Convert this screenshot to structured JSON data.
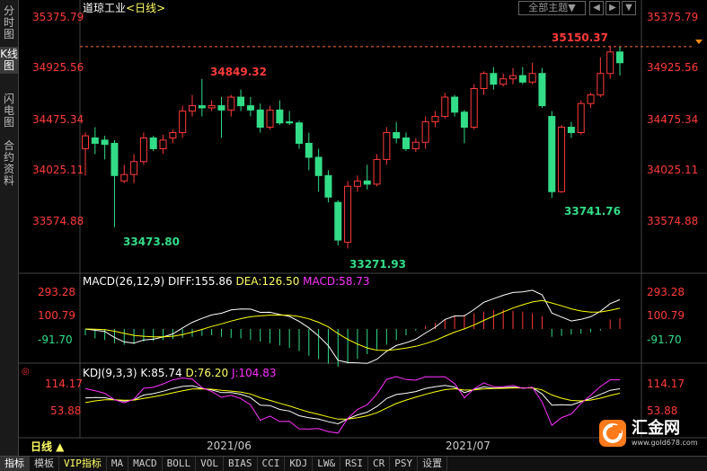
{
  "side_tabs": [
    "分时图",
    "K线图",
    "闪电图",
    "合约资料"
  ],
  "header": {
    "title": "道琼工业",
    "period": "<日线>"
  },
  "theme_button": "全部主题▼",
  "nav_buttons": [
    "◀",
    "▶",
    "▼"
  ],
  "price_axis": [
    "35375.79",
    "34925.56",
    "34475.34",
    "34025.11",
    "33574.88"
  ],
  "current_price": "35150.37",
  "annotations": {
    "high1": "34849.32",
    "low1": "33473.80",
    "low2": "33271.93",
    "low3": "33741.76"
  },
  "macd": {
    "title": "MACD(26,12,9)",
    "diff": "DIFF:155.86",
    "dea": "DEA:126.50",
    "macd": "MACD:58.73",
    "axis": [
      "293.28",
      "100.79",
      "-91.70"
    ]
  },
  "kdj": {
    "title": "KDJ(9,3,3)",
    "k": "K:85.74",
    "d": "D:76.20",
    "j": "J:104.83",
    "axis": [
      "114.17",
      "53.88"
    ]
  },
  "date_axis": [
    "2021/06",
    "2021/07"
  ],
  "period_selector": "日线 ▲",
  "bottom_tabs": [
    "指标",
    "模板",
    "VIP指标",
    "MA",
    "MACD",
    "BOLL",
    "VOL",
    "BIAS",
    "CCI",
    "KDJ",
    "LW&",
    "RSI",
    "CR",
    "PSY",
    "设置"
  ],
  "logo": {
    "name": "汇金网",
    "url": "www.gold678.com"
  },
  "colors": {
    "up": "#ff3b3b",
    "down": "#33dd88",
    "macd_diff": "#ffffff",
    "macd_dea": "#ffff00",
    "kdj_j": "#ff33ff"
  },
  "chart_data": {
    "type": "candlestick",
    "ohlc": [
      [
        34200,
        34350,
        33950,
        34320
      ],
      [
        34300,
        34400,
        34150,
        34250
      ],
      [
        34280,
        34320,
        34100,
        34240
      ],
      [
        34250,
        34280,
        33470,
        33950
      ],
      [
        33900,
        34050,
        33880,
        33960
      ],
      [
        33960,
        34150,
        33880,
        34080
      ],
      [
        34080,
        34350,
        34050,
        34300
      ],
      [
        34300,
        34320,
        34180,
        34200
      ],
      [
        34200,
        34330,
        34150,
        34280
      ],
      [
        34300,
        34380,
        34250,
        34350
      ],
      [
        34350,
        34600,
        34300,
        34550
      ],
      [
        34550,
        34700,
        34500,
        34600
      ],
      [
        34600,
        34849,
        34500,
        34580
      ],
      [
        34580,
        34650,
        34550,
        34600
      ],
      [
        34600,
        34680,
        34300,
        34560
      ],
      [
        34560,
        34700,
        34500,
        34680
      ],
      [
        34680,
        34750,
        34550,
        34600
      ],
      [
        34600,
        34680,
        34500,
        34560
      ],
      [
        34560,
        34620,
        34350,
        34400
      ],
      [
        34400,
        34600,
        34380,
        34560
      ],
      [
        34560,
        34650,
        34420,
        34440
      ],
      [
        34450,
        34550,
        34420,
        34440
      ],
      [
        34440,
        34460,
        34200,
        34250
      ],
      [
        34250,
        34350,
        34000,
        34120
      ],
      [
        34120,
        34200,
        33800,
        33950
      ],
      [
        33950,
        34000,
        33700,
        33750
      ],
      [
        33700,
        33720,
        33300,
        33350
      ],
      [
        33330,
        33900,
        33272,
        33850
      ],
      [
        33850,
        33950,
        33800,
        33900
      ],
      [
        33900,
        34050,
        33820,
        33870
      ],
      [
        33870,
        34150,
        33850,
        34100
      ],
      [
        34100,
        34400,
        34050,
        34350
      ],
      [
        34350,
        34450,
        34250,
        34300
      ],
      [
        34300,
        34350,
        34180,
        34200
      ],
      [
        34200,
        34300,
        34170,
        34260
      ],
      [
        34260,
        34500,
        34200,
        34450
      ],
      [
        34450,
        34550,
        34400,
        34500
      ],
      [
        34500,
        34720,
        34480,
        34680
      ],
      [
        34680,
        34700,
        34500,
        34540
      ],
      [
        34540,
        34560,
        34250,
        34400
      ],
      [
        34400,
        34800,
        34380,
        34760
      ],
      [
        34760,
        34920,
        34700,
        34900
      ],
      [
        34900,
        34960,
        34750,
        34800
      ],
      [
        34800,
        34900,
        34780,
        34850
      ],
      [
        34850,
        34950,
        34800,
        34880
      ],
      [
        34880,
        34960,
        34800,
        34820
      ],
      [
        34820,
        35000,
        34800,
        34900
      ],
      [
        34900,
        34950,
        34580,
        34600
      ],
      [
        34500,
        34550,
        33742,
        33800
      ],
      [
        33800,
        34420,
        33790,
        34400
      ],
      [
        34400,
        34450,
        34300,
        34350
      ],
      [
        34350,
        34650,
        34330,
        34620
      ],
      [
        34620,
        34720,
        34580,
        34700
      ],
      [
        34700,
        35050,
        34680,
        34900
      ],
      [
        34900,
        35160,
        34850,
        35100
      ],
      [
        35100,
        35150,
        34880,
        35000
      ]
    ],
    "macd_hist": [
      -20,
      -30,
      -35,
      -45,
      -50,
      -48,
      -40,
      -38,
      -35,
      -32,
      -28,
      -25,
      -22,
      -20,
      -25,
      -28,
      -30,
      -35,
      -40,
      -45,
      -52,
      -60,
      -70,
      -85,
      -95,
      -110,
      -120,
      -110,
      -95,
      -80,
      -65,
      -50,
      -35,
      -20,
      -5,
      10,
      20,
      30,
      40,
      45,
      50,
      55,
      60,
      62,
      58,
      55,
      50,
      40,
      -25,
      -22,
      -18,
      -15,
      -10,
      -5,
      30,
      35
    ],
    "price_range": [
      33200,
      35500
    ]
  }
}
